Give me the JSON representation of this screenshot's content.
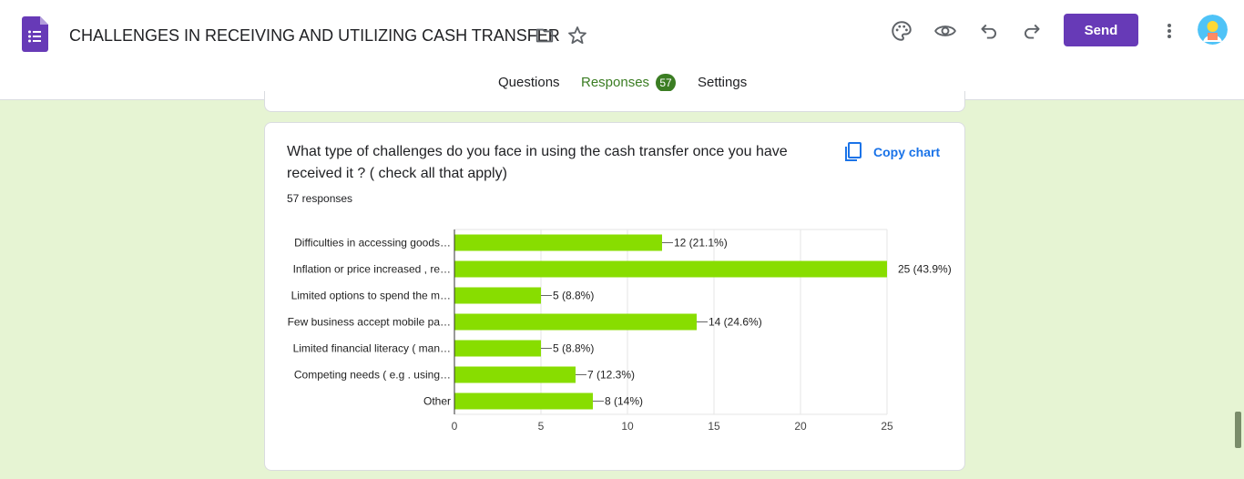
{
  "header": {
    "title": "CHALLENGES IN RECEIVING AND UTILIZING CASH TRANSFER",
    "send_label": "Send",
    "tabs": [
      {
        "label": "Questions",
        "active": false
      },
      {
        "label": "Responses",
        "active": true
      },
      {
        "label": "Settings",
        "active": false
      }
    ],
    "responses_badge": "57"
  },
  "colors": {
    "brand": "#673ab7",
    "accent": "#3b7d23",
    "bar": "#88dd00",
    "page_bg": "#e6f4d3"
  },
  "card": {
    "question": "What type of challenges do you face in using the cash transfer once you have received it ? ( check all that apply)",
    "responses_count": "57 responses",
    "copy_chart_label": "Copy chart"
  },
  "chart_data": {
    "type": "bar",
    "orientation": "horizontal",
    "categories": [
      "Difficulties in accessing goods…",
      "Inflation or price increased , re…",
      "Limited options to spend the m…",
      "Few business accept mobile pa…",
      "Limited financial literacy ( man…",
      "Competing needs ( e.g . using…",
      "Other"
    ],
    "values": [
      12,
      25,
      5,
      14,
      5,
      7,
      8
    ],
    "data_labels": [
      "12 (21.1%)",
      "25 (43.9%)",
      "5 (8.8%)",
      "14 (24.6%)",
      "5 (8.8%)",
      "7 (12.3%)",
      "8 (14%)"
    ],
    "xlim": [
      0,
      25
    ],
    "xticks": [
      0,
      5,
      10,
      15,
      20,
      25
    ],
    "grid": true,
    "title": "",
    "xlabel": "",
    "ylabel": ""
  }
}
